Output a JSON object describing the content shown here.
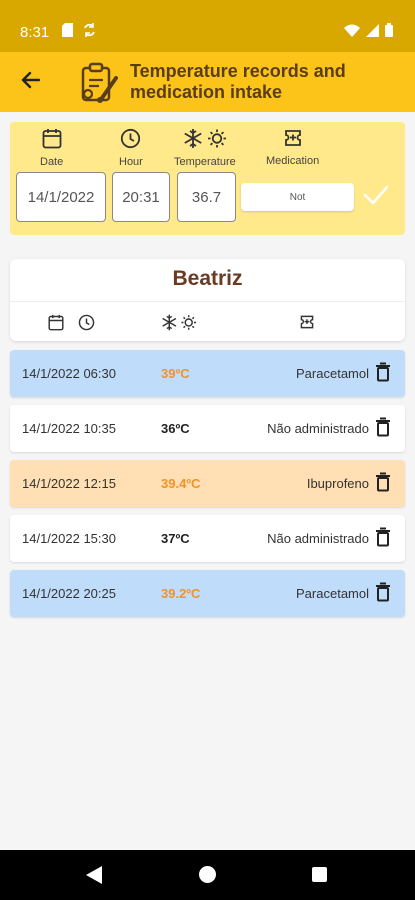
{
  "status_bar": {
    "time": "8:31"
  },
  "app_bar": {
    "title": "Temperature records and medication intake"
  },
  "form": {
    "date_label": "Date",
    "hour_label": "Hour",
    "temperature_label": "Temperature",
    "medication_label": "Medication",
    "date_value": "14/1/2022",
    "hour_value": "20:31",
    "temperature_value": "36.7",
    "medication_value": "Not"
  },
  "patient": {
    "name": "Beatriz"
  },
  "records": [
    {
      "datetime": "14/1/2022 06:30",
      "temperature": "39ºC",
      "medication": "Paracetamol"
    },
    {
      "datetime": "14/1/2022 10:35",
      "temperature": "36ºC",
      "medication": "Não administrado"
    },
    {
      "datetime": "14/1/2022 12:15",
      "temperature": "39.4ºC",
      "medication": "Ibuprofeno"
    },
    {
      "datetime": "14/1/2022 15:30",
      "temperature": "37ºC",
      "medication": "Não administrado"
    },
    {
      "datetime": "14/1/2022 20:25",
      "temperature": "39.2ºC",
      "medication": "Paracetamol"
    }
  ],
  "colors": {
    "status_bar": "#d9a800",
    "app_bar": "#fcc419",
    "form_bg": "#ffe98a",
    "paracetamol_row": "#bfdcfa",
    "ibuprofeno_row": "#ffdfb3",
    "plain_row": "#ffffff",
    "fever_text": "#f0932b",
    "normal_text": "#222222"
  },
  "icons": {
    "back": "arrow-left-icon",
    "logo": "clipboard-thermometer-icon",
    "date": "calendar-icon",
    "hour": "clock-icon",
    "temperature": "snowflake-sun-icon",
    "medication": "medication-icon",
    "confirm": "check-icon",
    "delete": "trash-icon"
  }
}
